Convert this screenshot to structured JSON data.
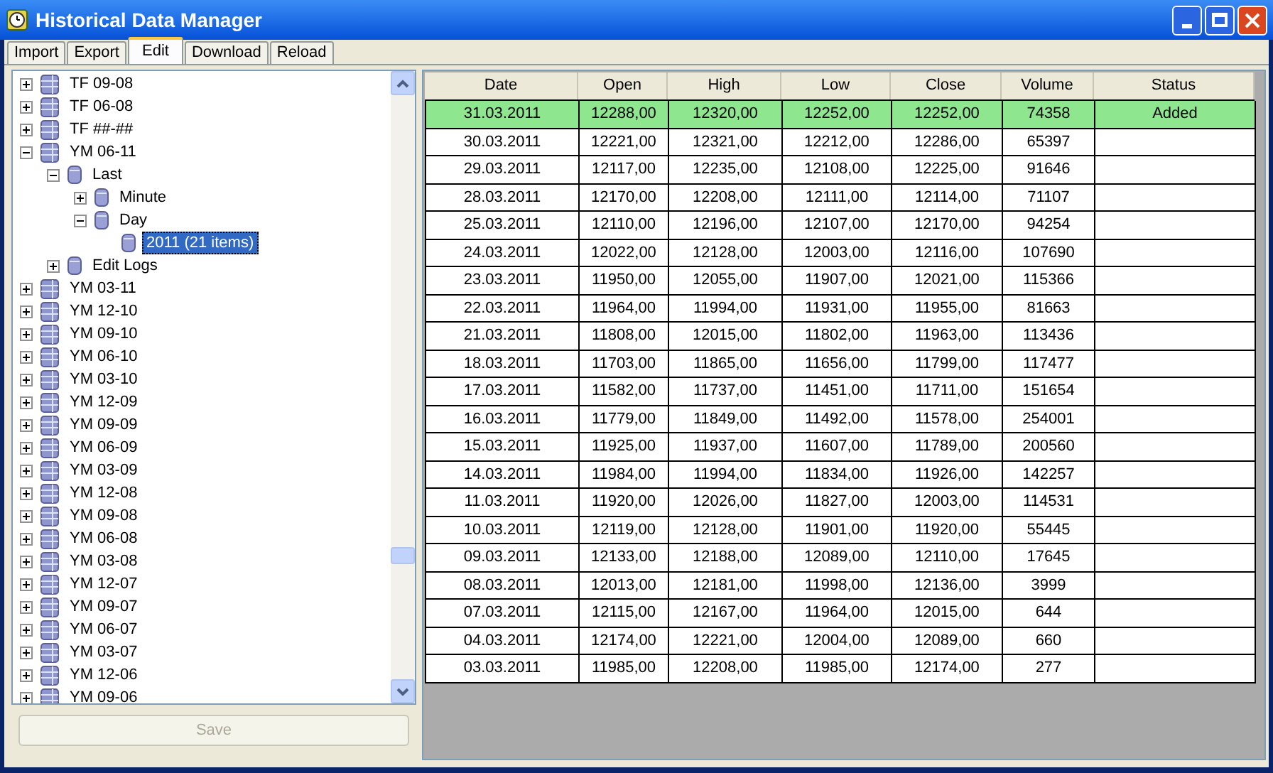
{
  "window": {
    "title": "Historical Data Manager"
  },
  "tabs": [
    {
      "label": "Import",
      "selected": false
    },
    {
      "label": "Export",
      "selected": false
    },
    {
      "label": "Edit",
      "selected": true
    },
    {
      "label": "Download",
      "selected": false
    },
    {
      "label": "Reload",
      "selected": false
    }
  ],
  "tree": [
    {
      "label": "TF 09-08",
      "expanded": false,
      "selected": false
    },
    {
      "label": "TF 06-08",
      "expanded": false,
      "selected": false
    },
    {
      "label": "TF ##-##",
      "expanded": false,
      "selected": false
    },
    {
      "label": "YM 06-11",
      "expanded": true,
      "selected": false,
      "children": [
        {
          "label": "Last",
          "expanded": true,
          "selected": false,
          "children": [
            {
              "label": "Minute",
              "expanded": false,
              "selected": false
            },
            {
              "label": "Day",
              "expanded": true,
              "selected": false,
              "children": [
                {
                  "label": "2011 (21 items)",
                  "selected": true
                }
              ]
            }
          ]
        },
        {
          "label": "Edit Logs",
          "expanded": false,
          "selected": false
        }
      ]
    },
    {
      "label": "YM 03-11",
      "expanded": false,
      "selected": false
    },
    {
      "label": "YM 12-10",
      "expanded": false,
      "selected": false
    },
    {
      "label": "YM 09-10",
      "expanded": false,
      "selected": false
    },
    {
      "label": "YM 06-10",
      "expanded": false,
      "selected": false
    },
    {
      "label": "YM 03-10",
      "expanded": false,
      "selected": false
    },
    {
      "label": "YM 12-09",
      "expanded": false,
      "selected": false
    },
    {
      "label": "YM 09-09",
      "expanded": false,
      "selected": false
    },
    {
      "label": "YM 06-09",
      "expanded": false,
      "selected": false
    },
    {
      "label": "YM 03-09",
      "expanded": false,
      "selected": false
    },
    {
      "label": "YM 12-08",
      "expanded": false,
      "selected": false
    },
    {
      "label": "YM 09-08",
      "expanded": false,
      "selected": false
    },
    {
      "label": "YM 06-08",
      "expanded": false,
      "selected": false
    },
    {
      "label": "YM 03-08",
      "expanded": false,
      "selected": false
    },
    {
      "label": "YM 12-07",
      "expanded": false,
      "selected": false
    },
    {
      "label": "YM 09-07",
      "expanded": false,
      "selected": false
    },
    {
      "label": "YM 06-07",
      "expanded": false,
      "selected": false
    },
    {
      "label": "YM 03-07",
      "expanded": false,
      "selected": false
    },
    {
      "label": "YM 12-06",
      "expanded": false,
      "selected": false
    },
    {
      "label": "YM 09-06",
      "expanded": false,
      "selected": false
    }
  ],
  "save_button": {
    "label": "Save",
    "disabled": true
  },
  "table": {
    "columns": [
      "Date",
      "Open",
      "High",
      "Low",
      "Close",
      "Volume",
      "Status"
    ],
    "rows": [
      {
        "cells": [
          "31.03.2011",
          "12288,00",
          "12320,00",
          "12252,00",
          "12252,00",
          "74358",
          "Added"
        ],
        "highlighted": true
      },
      {
        "cells": [
          "30.03.2011",
          "12221,00",
          "12321,00",
          "12212,00",
          "12286,00",
          "65397"
        ],
        "highlighted": false
      },
      {
        "cells": [
          "29.03.2011",
          "12117,00",
          "12235,00",
          "12108,00",
          "12225,00",
          "91646"
        ],
        "highlighted": false
      },
      {
        "cells": [
          "28.03.2011",
          "12170,00",
          "12208,00",
          "12111,00",
          "12114,00",
          "71107"
        ],
        "highlighted": false
      },
      {
        "cells": [
          "25.03.2011",
          "12110,00",
          "12196,00",
          "12107,00",
          "12170,00",
          "94254"
        ],
        "highlighted": false
      },
      {
        "cells": [
          "24.03.2011",
          "12022,00",
          "12128,00",
          "12003,00",
          "12116,00",
          "107690"
        ],
        "highlighted": false
      },
      {
        "cells": [
          "23.03.2011",
          "11950,00",
          "12055,00",
          "11907,00",
          "12021,00",
          "115366"
        ],
        "highlighted": false
      },
      {
        "cells": [
          "22.03.2011",
          "11964,00",
          "11994,00",
          "11931,00",
          "11955,00",
          "81663"
        ],
        "highlighted": false
      },
      {
        "cells": [
          "21.03.2011",
          "11808,00",
          "12015,00",
          "11802,00",
          "11963,00",
          "113436"
        ],
        "highlighted": false
      },
      {
        "cells": [
          "18.03.2011",
          "11703,00",
          "11865,00",
          "11656,00",
          "11799,00",
          "117477"
        ],
        "highlighted": false
      },
      {
        "cells": [
          "17.03.2011",
          "11582,00",
          "11737,00",
          "11451,00",
          "11711,00",
          "151654"
        ],
        "highlighted": false
      },
      {
        "cells": [
          "16.03.2011",
          "11779,00",
          "11849,00",
          "11492,00",
          "11578,00",
          "254001"
        ],
        "highlighted": false
      },
      {
        "cells": [
          "15.03.2011",
          "11925,00",
          "11937,00",
          "11607,00",
          "11789,00",
          "200560"
        ],
        "highlighted": false
      },
      {
        "cells": [
          "14.03.2011",
          "11984,00",
          "11994,00",
          "11834,00",
          "11926,00",
          "142257"
        ],
        "highlighted": false
      },
      {
        "cells": [
          "11.03.2011",
          "11920,00",
          "12026,00",
          "11827,00",
          "12003,00",
          "114531"
        ],
        "highlighted": false
      },
      {
        "cells": [
          "10.03.2011",
          "12119,00",
          "12128,00",
          "11901,00",
          "11920,00",
          "55445"
        ],
        "highlighted": false
      },
      {
        "cells": [
          "09.03.2011",
          "12133,00",
          "12188,00",
          "12089,00",
          "12110,00",
          "17645"
        ],
        "highlighted": false
      },
      {
        "cells": [
          "08.03.2011",
          "12013,00",
          "12181,00",
          "11998,00",
          "12136,00",
          "3999"
        ],
        "highlighted": false
      },
      {
        "cells": [
          "07.03.2011",
          "12115,00",
          "12167,00",
          "11964,00",
          "12015,00",
          "644"
        ],
        "highlighted": false
      },
      {
        "cells": [
          "04.03.2011",
          "12174,00",
          "12221,00",
          "12004,00",
          "12089,00",
          "660"
        ],
        "highlighted": false
      },
      {
        "cells": [
          "03.03.2011",
          "11985,00",
          "12208,00",
          "11985,00",
          "12174,00",
          "277"
        ],
        "highlighted": false
      }
    ]
  }
}
